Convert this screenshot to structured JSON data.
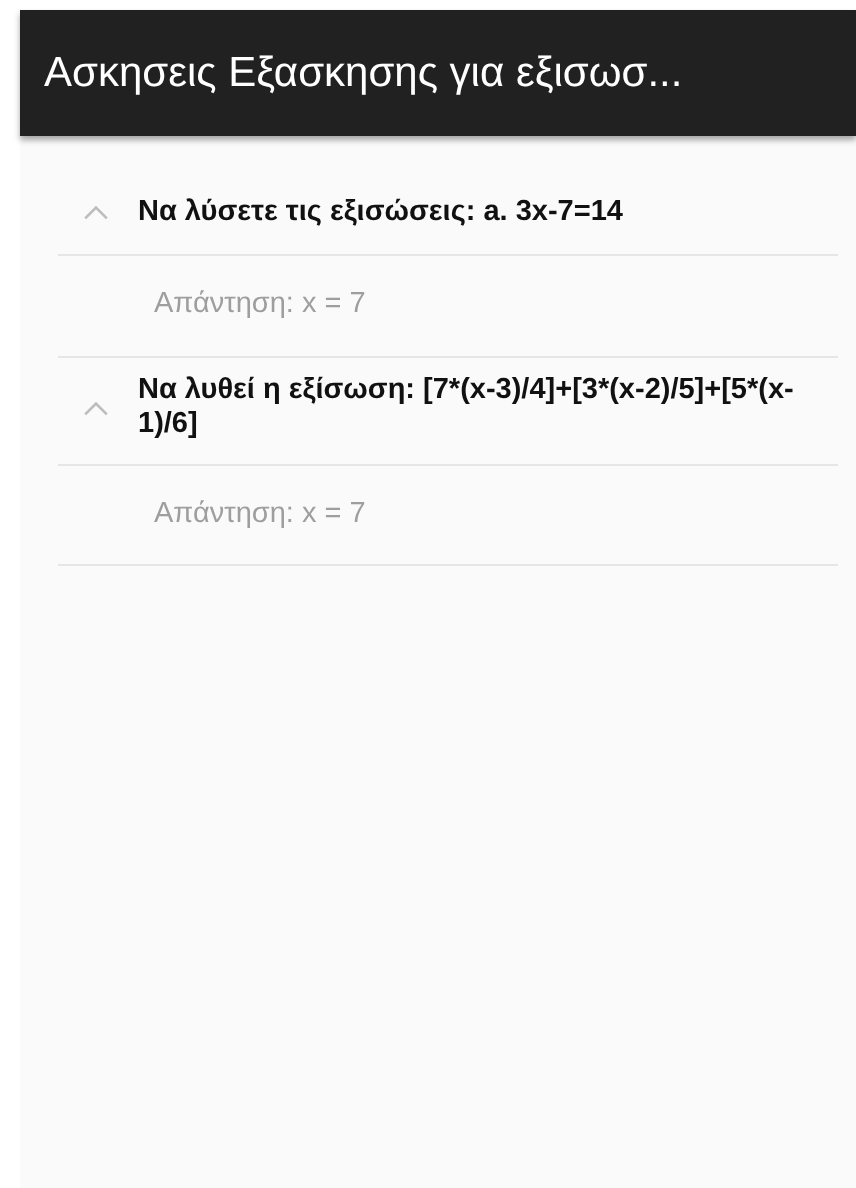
{
  "app_bar": {
    "title": "Ασκησεις Εξασκησης για εξισωσ..."
  },
  "exercises": [
    {
      "question": "Να λύσετε τις εξισώσεις: a. 3x-7=14",
      "expanded": true,
      "answer": "Απάντηση: x = 7"
    },
    {
      "question": "Να λυθεί η εξίσωση: [7*(x-3)/4]+[3*(x-2)/5]+[5*(x-1)/6]",
      "expanded": true,
      "answer": "Απάντηση: x = 7"
    }
  ]
}
